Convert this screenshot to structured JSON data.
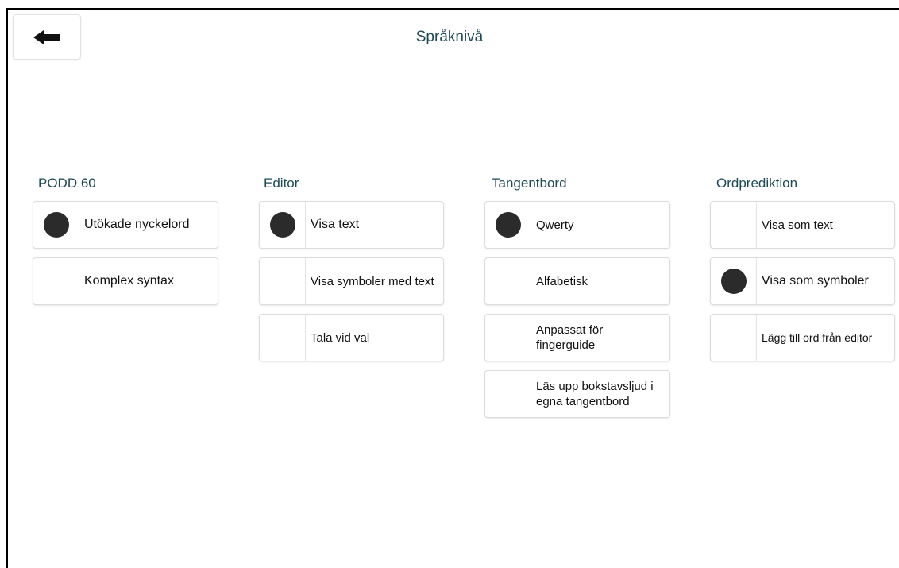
{
  "header": {
    "title": "Språknivå",
    "back_icon": "arrow-left-icon"
  },
  "colors": {
    "accent_text": "#1e4a56",
    "selected_dot": "#2b2b2b"
  },
  "groups": [
    {
      "title": "PODD 60",
      "options": [
        {
          "label": "Utökade nyckelord",
          "selected": true
        },
        {
          "label": "Komplex syntax",
          "selected": false
        }
      ]
    },
    {
      "title": "Editor",
      "options": [
        {
          "label": "Visa text",
          "selected": true
        },
        {
          "label": "Visa symboler med text",
          "selected": false
        },
        {
          "label": "Tala vid val",
          "selected": false
        }
      ]
    },
    {
      "title": "Tangentbord",
      "options": [
        {
          "label": "Qwerty",
          "selected": true
        },
        {
          "label": "Alfabetisk",
          "selected": false
        },
        {
          "label": "Anpassat för fingerguide",
          "selected": false
        },
        {
          "label": "Läs upp bokstavsljud i egna tangentbord",
          "selected": false
        }
      ]
    },
    {
      "title": "Ordprediktion",
      "options": [
        {
          "label": "Visa som text",
          "selected": false
        },
        {
          "label": "Visa som symboler",
          "selected": true
        },
        {
          "label": "Lägg till ord från editor",
          "selected": false
        }
      ]
    }
  ]
}
